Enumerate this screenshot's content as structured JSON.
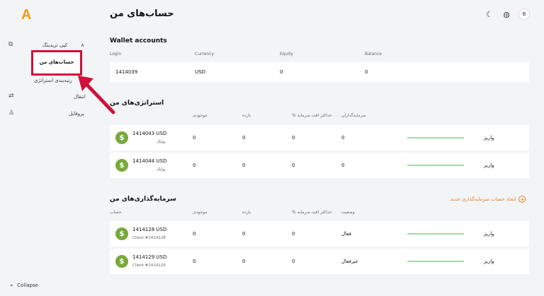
{
  "header": {
    "logo": "A",
    "title": "حساب‌های من",
    "avatar": "B"
  },
  "sidebar": {
    "copy_trading": "کپی تریدینگ",
    "my_accounts": "حساب‌های من",
    "strategy_ranking": "رتبه‌بندی استراتژی",
    "transfer": "انتقال",
    "profile": "پروفایل",
    "collapse": "Collapse"
  },
  "wallet": {
    "title": "Wallet accounts",
    "headers": [
      "Login",
      "Currency",
      "Equity",
      "Balance"
    ],
    "row": [
      "1414039",
      "USD",
      "0",
      "0"
    ]
  },
  "strategies": {
    "title": "استراتژی‌های من",
    "headers": [
      "موجودی",
      "بازده",
      "% حداکثر افت سرمایه",
      "سرمایه‌گذاران"
    ],
    "rows": [
      {
        "account": "1414043 USD",
        "sub": "پولیک",
        "balance": "0",
        "return": "0",
        "drawdown": "0",
        "investors": "0",
        "action": "واریز"
      },
      {
        "account": "1414044 USD",
        "sub": "پولیک",
        "balance": "0",
        "return": "0",
        "drawdown": "0",
        "investors": "0",
        "action": "واریز"
      }
    ]
  },
  "investments": {
    "title": "سرمایه‌گذاری‌های من",
    "create_link": "ایجاد حساب سرمایه‌گذاری جدید",
    "headers": [
      "حساب",
      "موجودی",
      "بازده",
      "% حداکثر افت سرمایه",
      "وضعیت"
    ],
    "rows": [
      {
        "account": "1414128 USD",
        "sub": "Client #1414128",
        "balance": "0",
        "return": "0",
        "drawdown": "0",
        "status": "فعال",
        "action": "واریز"
      },
      {
        "account": "1414129 USD",
        "sub": "Client #1414129",
        "balance": "0",
        "return": "0",
        "drawdown": "0",
        "status": "غیرفعال",
        "action": "واریز"
      }
    ]
  },
  "colors": {
    "accent": "#f39c12",
    "highlight": "#d0103a",
    "dollar": "#78a93b",
    "bar": "#a6d9a8"
  }
}
